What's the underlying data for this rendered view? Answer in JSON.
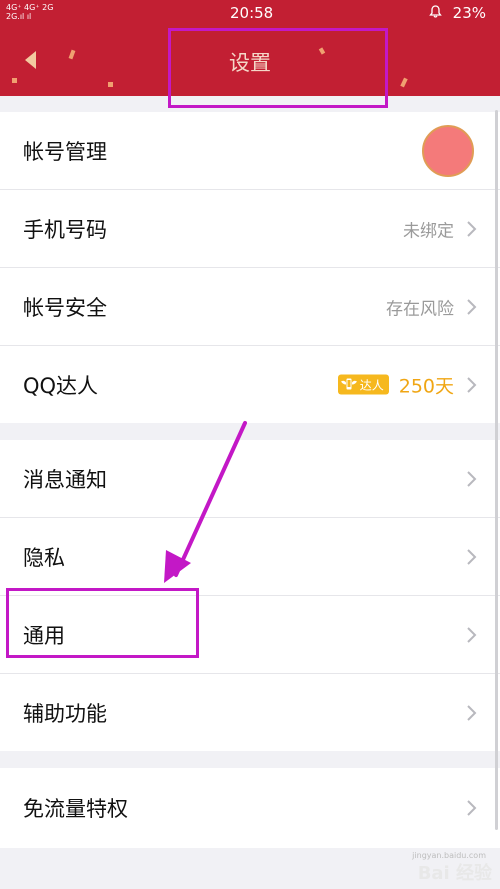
{
  "status_bar": {
    "network": "4G⁺ 4G⁺ 2G\n2G.ıl ıl",
    "time": "20:58",
    "battery": "23%"
  },
  "header": {
    "title": "设置"
  },
  "groups": [
    {
      "rows": [
        {
          "label": "帐号管理",
          "type": "avatar"
        },
        {
          "label": "手机号码",
          "value": "未绑定"
        },
        {
          "label": "帐号安全",
          "value": "存在风险"
        },
        {
          "label": "QQ达人",
          "badge_text": "达人",
          "days": "250天"
        }
      ]
    },
    {
      "rows": [
        {
          "label": "消息通知"
        },
        {
          "label": "隐私"
        },
        {
          "label": "通用"
        },
        {
          "label": "辅助功能"
        }
      ]
    },
    {
      "rows": [
        {
          "label": "免流量特权"
        }
      ]
    }
  ],
  "watermark": {
    "text": "Bai 经验",
    "sub": "jingyan.baidu.com"
  },
  "colors": {
    "header": "#c21f33",
    "annotation": "#c318c6",
    "badge": "#f6b81e"
  }
}
